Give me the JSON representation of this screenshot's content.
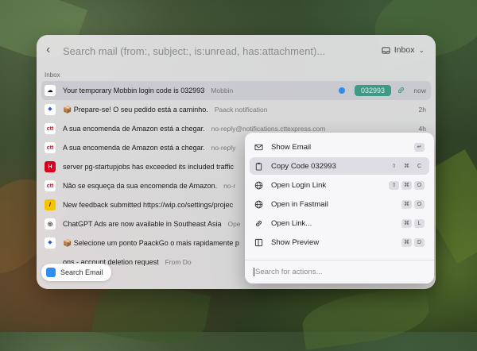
{
  "search": {
    "placeholder": "Search mail (from:, subject:, is:unread, has:attachment)..."
  },
  "mailbox": {
    "label": "Inbox"
  },
  "section_label": "Inbox",
  "emails": [
    {
      "subject": "Your temporary Mobbin login code is 032993",
      "from": "Mobbin",
      "time": "now",
      "code": "032993",
      "icon": "mobbin-logo-icon",
      "icon_bg": "#ffffff",
      "icon_fg": "#111111",
      "icon_text": "☁",
      "selected": true
    },
    {
      "subject": "📦 Prepare-se! O seu pedido está a caminho.",
      "from": "Paack notification",
      "time": "2h",
      "icon": "paack-logo-icon",
      "icon_bg": "#ffffff",
      "icon_fg": "#2a5bd7",
      "icon_text": "⬥"
    },
    {
      "subject": "A sua encomenda de Amazon está a chegar.",
      "from": "no-reply@notifications.cttexpress.com",
      "time": "4h",
      "icon": "ctt-logo-icon",
      "icon_bg": "#ffffff",
      "icon_fg": "#d6001c",
      "icon_text": "ctt"
    },
    {
      "subject": "A sua encomenda de Amazon está a chegar.",
      "from": "no-reply",
      "time": "",
      "icon": "ctt-logo-icon",
      "icon_bg": "#ffffff",
      "icon_fg": "#d6001c",
      "icon_text": "ctt"
    },
    {
      "subject": "server pg-startupjobs has exceeded its included traffic",
      "from": "",
      "time": "",
      "icon": "heroku-logo-icon",
      "icon_bg": "#d6001c",
      "icon_fg": "#ffffff",
      "icon_text": "H"
    },
    {
      "subject": "Não se esqueça da sua encomenda de Amazon.",
      "from": "no-r",
      "time": "",
      "icon": "ctt-logo-icon",
      "icon_bg": "#ffffff",
      "icon_fg": "#d6001c",
      "icon_text": "ctt"
    },
    {
      "subject": "New feedback submitted https://wip.co/settings/projec",
      "from": "",
      "time": "",
      "icon": "wip-logo-icon",
      "icon_bg": "#f5c400",
      "icon_fg": "#111111",
      "icon_text": "/"
    },
    {
      "subject": "ChatGPT Ads are now available in Southeast Asia",
      "from": "Ope",
      "time": "",
      "icon": "openai-logo-icon",
      "icon_bg": "#ffffff",
      "icon_fg": "#111111",
      "icon_text": "◎"
    },
    {
      "subject": "📦 Selecione um ponto PaackGo o mais rapidamente p",
      "from": "",
      "time": "",
      "icon": "paack-logo-icon",
      "icon_bg": "#ffffff",
      "icon_fg": "#2a5bd7",
      "icon_text": "⬥"
    },
    {
      "subject": "ons - account deletion request",
      "from": "From Do",
      "time": "",
      "icon": "",
      "icon_bg": "transparent",
      "icon_fg": "transparent",
      "icon_text": ""
    }
  ],
  "search_email_button": {
    "label": "Search Email"
  },
  "actions_menu": {
    "items": [
      {
        "label": "Show Email",
        "keys": [
          "↵"
        ],
        "icon": "mail-icon"
      },
      {
        "label": "Copy Code 032993",
        "keys": [
          "⇧",
          "⌘",
          "C"
        ],
        "icon": "clipboard-icon",
        "highlighted": true
      },
      {
        "label": "Open Login Link",
        "keys": [
          "⇧",
          "⌘",
          "O"
        ],
        "icon": "globe-icon"
      },
      {
        "label": "Open in Fastmail",
        "keys": [
          "⌘",
          "O"
        ],
        "icon": "globe-icon"
      },
      {
        "label": "Open Link...",
        "keys": [
          "⌘",
          "L"
        ],
        "icon": "link-icon"
      },
      {
        "label": "Show Preview",
        "keys": [
          "⌘",
          "D"
        ],
        "icon": "preview-icon"
      }
    ],
    "search_placeholder": "Search for actions..."
  },
  "colors": {
    "accent": "#2f8df0",
    "code_badge": "#3e9a86"
  }
}
